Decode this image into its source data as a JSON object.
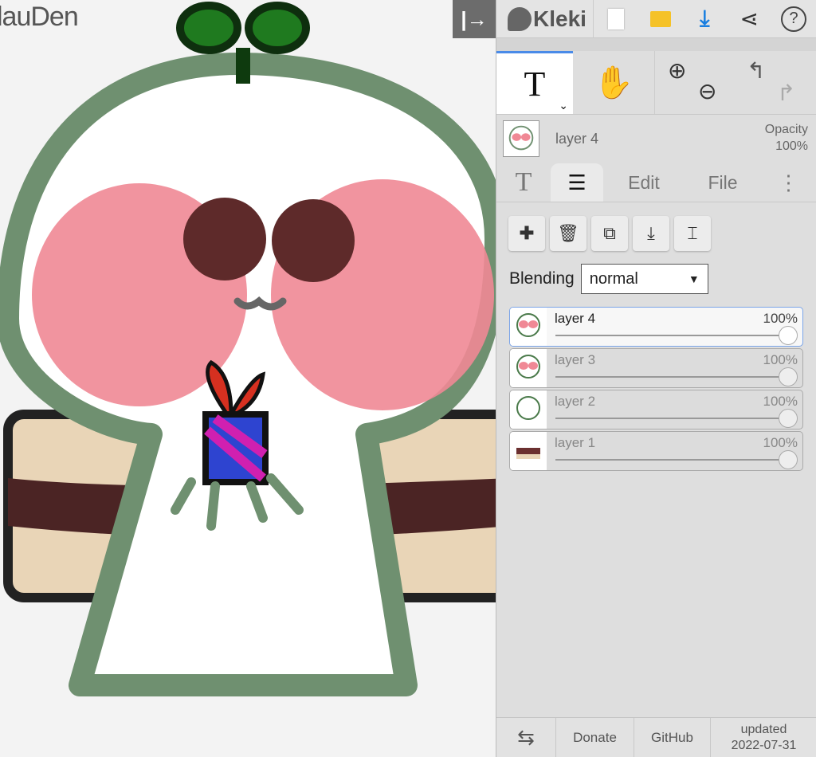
{
  "document": {
    "title_fragment": "lauDen"
  },
  "panel": {
    "collapse_icon": "collapse-right-icon",
    "logo": "Kleki",
    "topbar_icons": [
      "new-file-icon",
      "open-folder-icon",
      "download-icon",
      "share-icon",
      "help-icon"
    ],
    "tools": {
      "active": "text",
      "items": [
        "text-tool",
        "hand-tool",
        "zoom",
        "undo-redo"
      ]
    },
    "current_layer": {
      "name": "layer 4",
      "opacity_label": "Opacity",
      "opacity": "100%"
    },
    "tabs": [
      "T",
      "layers",
      "Edit",
      "File",
      "more"
    ],
    "tab_labels": {
      "edit": "Edit",
      "file": "File",
      "text": "T"
    },
    "layer_buttons": [
      "add-layer",
      "delete-layer",
      "duplicate-layer",
      "merge-down",
      "rename-layer"
    ],
    "blending": {
      "label": "Blending",
      "value": "normal"
    },
    "layers": [
      {
        "name": "layer 4",
        "opacity": "100%",
        "opacity_value": 1.0,
        "selected": true
      },
      {
        "name": "layer 3",
        "opacity": "100%",
        "opacity_value": 1.0,
        "selected": false
      },
      {
        "name": "layer 2",
        "opacity": "100%",
        "opacity_value": 1.0,
        "selected": false
      },
      {
        "name": "layer 1",
        "opacity": "100%",
        "opacity_value": 1.0,
        "selected": false
      }
    ],
    "footer": {
      "donate": "Donate",
      "github": "GitHub",
      "updated_label": "updated",
      "updated_date": "2022-07-31"
    },
    "colors": {
      "accent": "#4a8be8",
      "download": "#1a7fe0",
      "folder": "#f5c228"
    }
  }
}
